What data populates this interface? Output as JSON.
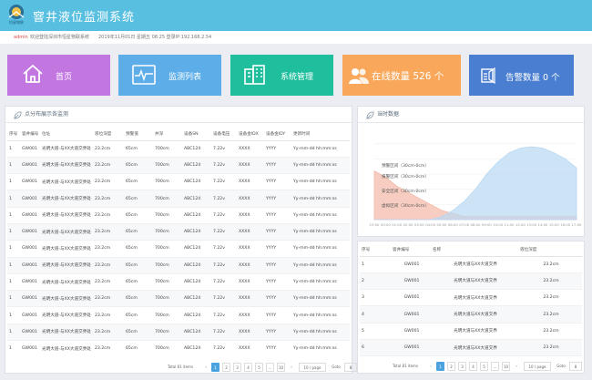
{
  "header": {
    "logo_text": "恒星物联",
    "title": "窨井液位监测系统"
  },
  "info": {
    "user": "admin",
    "welcome": "欢迎登陆深圳市恒星物联系统",
    "datetime": "2019年11月01日 星期五 08:25 登录IP:192.168.2.54"
  },
  "tiles": [
    {
      "label": "首页",
      "color": "#c176e0"
    },
    {
      "label": "监测列表",
      "color": "#5dade8"
    },
    {
      "label": "系统管理",
      "color": "#1fbe9c"
    },
    {
      "label": "在线数量 526 个",
      "color": "#f9a85b"
    },
    {
      "label": "告警数量 0 个",
      "color": "#4a7ed0"
    }
  ],
  "left_panel": {
    "title": "点分布展示各监测",
    "columns": [
      "序号",
      "窨井编号",
      "位址",
      "液位深度",
      "预警值",
      "井深",
      "设备SN",
      "设备电压",
      "设备金IDX",
      "设备金IDY",
      "更新时间"
    ],
    "rows": [
      [
        "1",
        "GW001",
        "光明大道-与XX大道交界处",
        "23.2cm",
        "65cm",
        "700cm",
        "ABC124",
        "7.22v",
        "XXXX",
        "YYYY",
        "Yy-mm-dd hh:mm:ss"
      ],
      [
        "1",
        "GW001",
        "光明大道-与XX大道交界处",
        "23.2cm",
        "65cm",
        "700cm",
        "ABC124",
        "7.22v",
        "XXXX",
        "YYYY",
        "Yy-mm-dd hh:mm:ss"
      ],
      [
        "1",
        "GW001",
        "光明大道-与XX大道交界处",
        "23.2cm",
        "65cm",
        "700cm",
        "ABC124",
        "7.22v",
        "XXXX",
        "YYYY",
        "Yy-mm-dd hh:mm:ss"
      ],
      [
        "1",
        "GW001",
        "光明大道-与XX大道交界处",
        "23.2cm",
        "65cm",
        "700cm",
        "ABC124",
        "7.22v",
        "XXXX",
        "YYYY",
        "Yy-mm-dd hh:mm:ss"
      ],
      [
        "1",
        "GW001",
        "光明大道-与XX大道交界处",
        "23.2cm",
        "65cm",
        "700cm",
        "ABC124",
        "7.22v",
        "XXXX",
        "YYYY",
        "Yy-mm-dd hh:mm:ss"
      ],
      [
        "1",
        "GW001",
        "光明大道-与XX大道交界处",
        "23.2cm",
        "65cm",
        "700cm",
        "ABC124",
        "7.22v",
        "XXXX",
        "YYYY",
        "Yy-mm-dd hh:mm:ss"
      ],
      [
        "1",
        "GW001",
        "光明大道-与XX大道交界处",
        "23.2cm",
        "65cm",
        "700cm",
        "ABC124",
        "7.22v",
        "XXXX",
        "YYYY",
        "Yy-mm-dd hh:mm:ss"
      ],
      [
        "1",
        "GW001",
        "光明大道-与XX大道交界处",
        "23.2cm",
        "65cm",
        "700cm",
        "ABC124",
        "7.22v",
        "XXXX",
        "YYYY",
        "Yy-mm-dd hh:mm:ss"
      ],
      [
        "1",
        "GW001",
        "光明大道-与XX大道交界处",
        "23.2cm",
        "65cm",
        "700cm",
        "ABC124",
        "7.22v",
        "XXXX",
        "YYYY",
        "Yy-mm-dd hh:mm:ss"
      ],
      [
        "1",
        "GW001",
        "光明大道-与XX大道交界处",
        "23.2cm",
        "65cm",
        "700cm",
        "ABC124",
        "7.22v",
        "XXXX",
        "YYYY",
        "Yy-mm-dd hh:mm:ss"
      ],
      [
        "1",
        "GW001",
        "光明大道-与XX大道交界处",
        "23.2cm",
        "65cm",
        "700cm",
        "ABC124",
        "7.22v",
        "XXXX",
        "YYYY",
        "Yy-mm-dd hh:mm:ss"
      ],
      [
        "1",
        "GW001",
        "光明大道-与XX大道交界处",
        "23.2cm",
        "65cm",
        "700cm",
        "ABC124",
        "7.22v",
        "XXXX",
        "YYYY",
        "Yy-mm-dd hh:mm:ss"
      ],
      [
        "1",
        "GW001",
        "光明大道-与XX大道交界处",
        "23.2cm",
        "65cm",
        "700cm",
        "ABC124",
        "7.22v",
        "XXXX",
        "YYYY",
        "Yy-mm-dd hh:mm:ss"
      ]
    ],
    "pagination": {
      "total": "Total 81 items",
      "pages": [
        "1",
        "2",
        "3",
        "4",
        "5",
        "...",
        "10"
      ],
      "per_page": "10 / page",
      "goto": "Goto",
      "goto_value": "8"
    }
  },
  "chart_panel": {
    "title": "当时数据"
  },
  "chart_data": {
    "type": "area",
    "x": [
      "23:00",
      "00:00",
      "01:00",
      "02:00",
      "03:00",
      "04:00",
      "05:00",
      "06:00",
      "07:00",
      "08:00",
      "09:00",
      "10:00",
      "11:00",
      "12:00",
      "13:00",
      "14:00",
      "15:00",
      "16:00",
      "17:00"
    ],
    "bands": [
      "预警区间（30cm-0cm）",
      "报警区间（30cm-0cm）",
      "安全区间（30cm-0cm）",
      "虚拟区间（30cm-0cm）"
    ],
    "series": [
      {
        "values": [
          1.6,
          1.4,
          1.1,
          0.9,
          0.7,
          0.5,
          0.3,
          0.2,
          0.1,
          0.1,
          0.1,
          0.1,
          0.1,
          0.1,
          0.1,
          0.1,
          0.1,
          0.1,
          0.1
        ],
        "color": "#f3b8a8"
      },
      {
        "values": [
          0,
          0,
          0,
          0,
          0,
          0,
          0.1,
          0.3,
          0.6,
          1.0,
          1.5,
          1.9,
          2.2,
          2.35,
          2.4,
          2.35,
          2.2,
          2.0,
          1.7
        ],
        "color": "#b8d8f2"
      }
    ]
  },
  "right_table": {
    "columns": [
      "序号",
      "窨井编号",
      "名称",
      "液位深度"
    ],
    "rows": [
      [
        "1",
        "GW001",
        "光明大道与XX大道交界",
        "23.2cm"
      ],
      [
        "2",
        "GW001",
        "光明大道与XX大道交界",
        "23.2cm"
      ],
      [
        "3",
        "GW001",
        "光明大道与XX大道交界",
        "23.2cm"
      ],
      [
        "4",
        "GW001",
        "光明大道与XX大道交界",
        "23.2cm"
      ],
      [
        "5",
        "GW001",
        "光明大道与XX大道交界",
        "23.2cm"
      ],
      [
        "6",
        "GW001",
        "光明大道与XX大道交界",
        "23.2cm"
      ],
      [
        "7",
        "GW001",
        "光明大道与XX大道交界",
        "23.2cm"
      ]
    ],
    "pagination": {
      "total": "Total 81 items",
      "pages": [
        "1",
        "2",
        "3",
        "4",
        "5",
        "...",
        "10"
      ],
      "per_page": "10 / page",
      "goto": "Goto",
      "goto_value": "8"
    }
  }
}
